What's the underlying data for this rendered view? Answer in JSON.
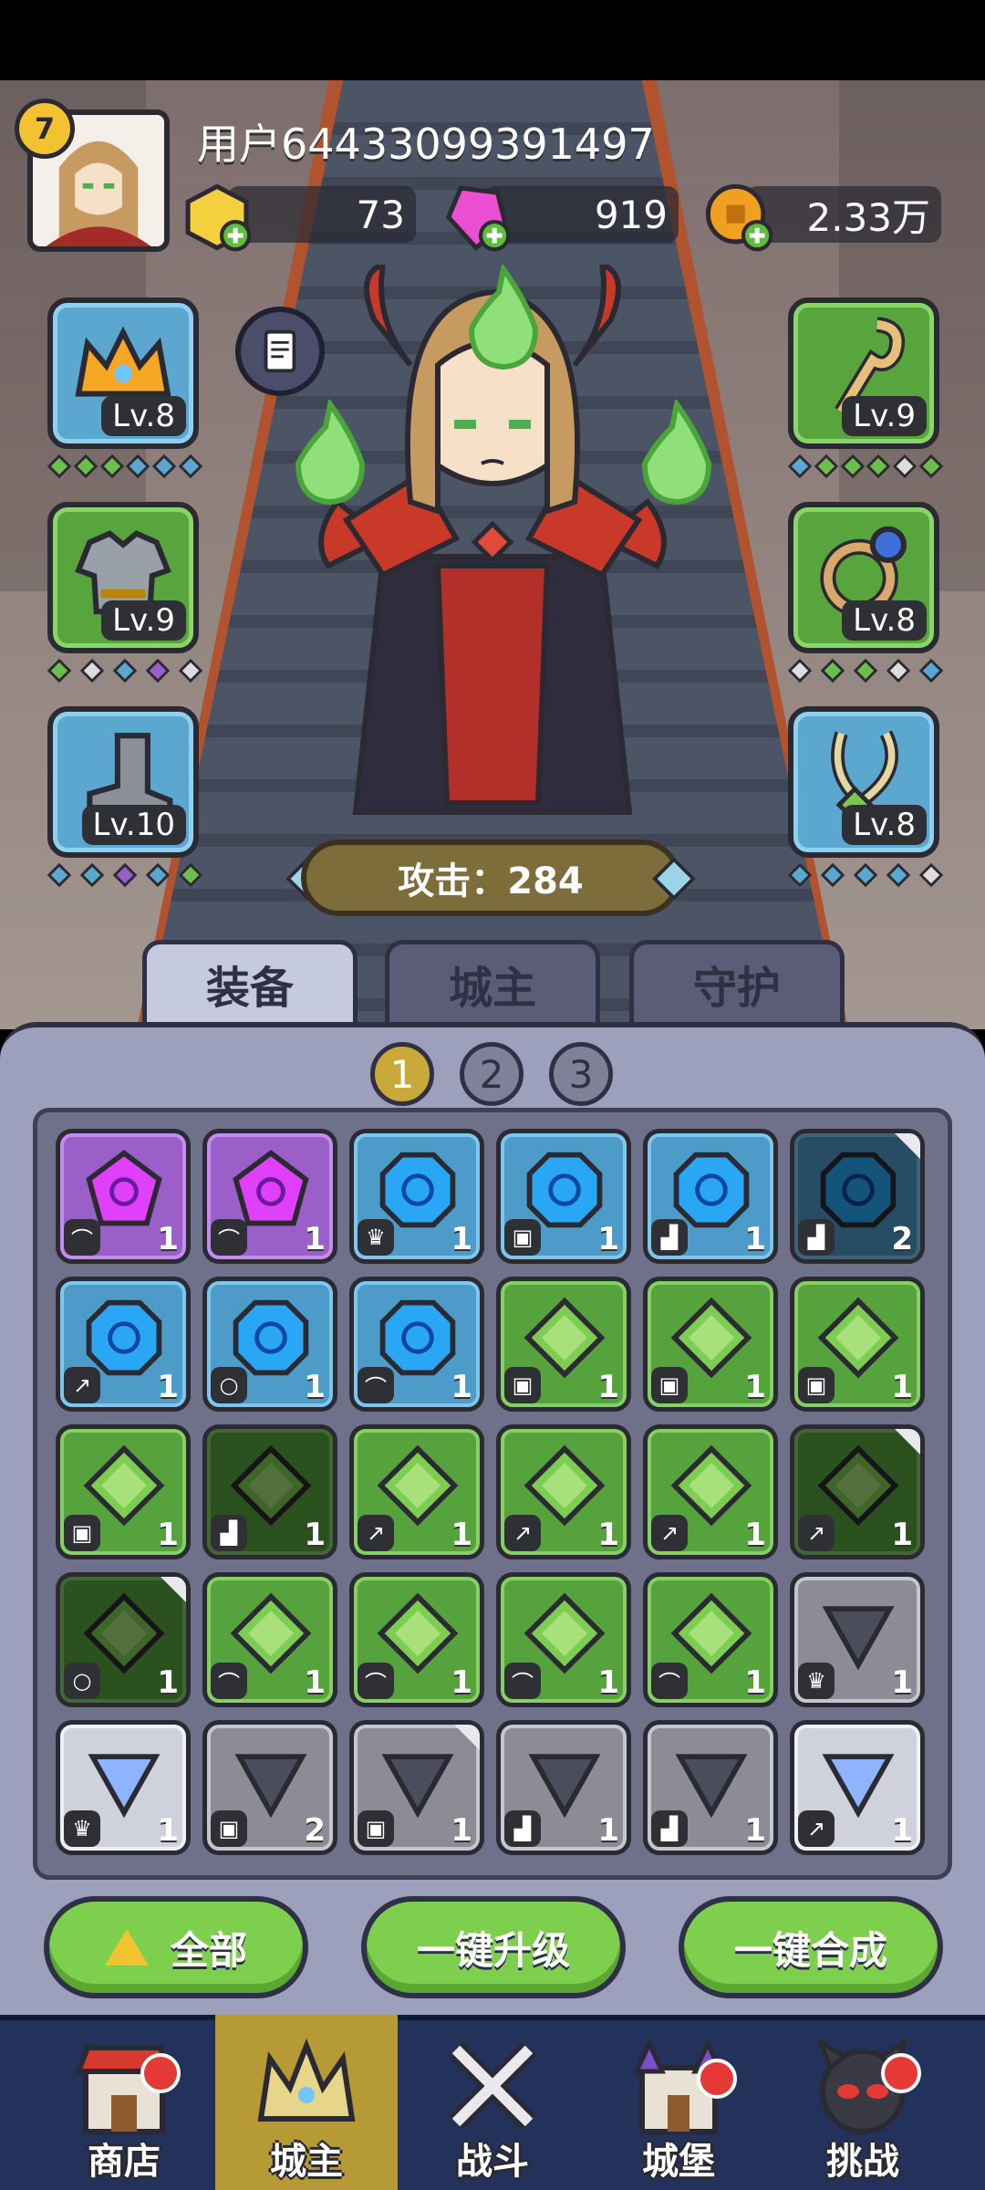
{
  "player": {
    "level": "7",
    "username": "用户64433099391497"
  },
  "resources": [
    {
      "name": "gold-cube",
      "value": "73",
      "color": "#f4d03f"
    },
    {
      "name": "pink-gem",
      "value": "919",
      "color": "#e94fd0"
    },
    {
      "name": "coin",
      "value": "2.33万",
      "color": "#f0a020"
    }
  ],
  "equipment": {
    "left": [
      {
        "item": "crown",
        "level": "Lv.8",
        "rarity": "blue"
      },
      {
        "item": "armor",
        "level": "Lv.9",
        "rarity": "green"
      },
      {
        "item": "boots",
        "level": "Lv.10",
        "rarity": "blue"
      }
    ],
    "right": [
      {
        "item": "staff",
        "level": "Lv.9",
        "rarity": "green"
      },
      {
        "item": "ring",
        "level": "Lv.8",
        "rarity": "green"
      },
      {
        "item": "necklace",
        "level": "Lv.8",
        "rarity": "blue"
      }
    ]
  },
  "attack_label": "攻击：284",
  "tabs": [
    "装备",
    "城主",
    "守护"
  ],
  "pages": [
    "1",
    "2",
    "3"
  ],
  "inventory": [
    [
      "purple",
      "bow",
      "1"
    ],
    [
      "purple",
      "bow",
      "1"
    ],
    [
      "blue",
      "crown",
      "1"
    ],
    [
      "blue",
      "armor",
      "1"
    ],
    [
      "blue",
      "boots",
      "1"
    ],
    [
      "blue-dim",
      "boots",
      "2"
    ],
    [
      "blue",
      "staff",
      "1"
    ],
    [
      "blue",
      "ring",
      "1"
    ],
    [
      "blue",
      "bow",
      "1"
    ],
    [
      "green",
      "armor",
      "1"
    ],
    [
      "green",
      "armor",
      "1"
    ],
    [
      "green",
      "armor",
      "1"
    ],
    [
      "green",
      "armor",
      "1"
    ],
    [
      "green-dim",
      "boots",
      "1"
    ],
    [
      "green",
      "staff",
      "1"
    ],
    [
      "green",
      "staff",
      "1"
    ],
    [
      "green",
      "staff",
      "1"
    ],
    [
      "green-dim",
      "staff",
      "1"
    ],
    [
      "green-dim",
      "ring",
      "1"
    ],
    [
      "green",
      "bow",
      "1"
    ],
    [
      "green",
      "bow",
      "1"
    ],
    [
      "green",
      "bow",
      "1"
    ],
    [
      "green",
      "bow",
      "1"
    ],
    [
      "grey",
      "crown",
      "1"
    ],
    [
      "white",
      "crown",
      "1"
    ],
    [
      "grey",
      "armor",
      "2"
    ],
    [
      "grey",
      "armor",
      "1"
    ],
    [
      "grey",
      "boots",
      "1"
    ],
    [
      "grey",
      "boots",
      "1"
    ],
    [
      "white",
      "staff",
      "1"
    ]
  ],
  "actions": {
    "all": "全部",
    "upgrade": "一键升级",
    "merge": "一键合成"
  },
  "nav": [
    "商店",
    "城主",
    "战斗",
    "城堡",
    "挑战"
  ]
}
